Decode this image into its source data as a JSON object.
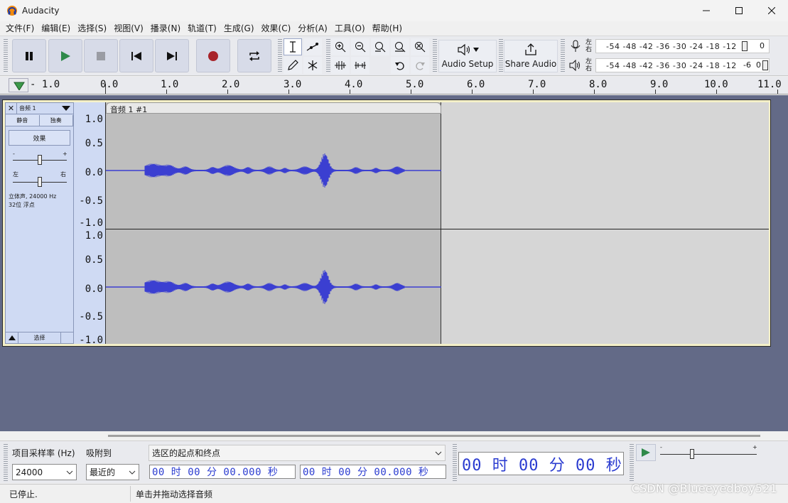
{
  "window": {
    "title": "Audacity"
  },
  "menu": [
    "文件(F)",
    "编辑(E)",
    "选择(S)",
    "视图(V)",
    "播录(N)",
    "轨道(T)",
    "生成(G)",
    "效果(C)",
    "分析(A)",
    "工具(O)",
    "帮助(H)"
  ],
  "toolbar": {
    "audio_setup_label": "Audio Setup",
    "share_audio_label": "Share Audio",
    "record_meter_ticks": "-54 -48 -42 -36 -30 -24 -18 -12",
    "record_meter_end": "0",
    "play_meter_ticks": "-54 -48 -42 -36 -30 -24 -18 -12",
    "play_meter_end": "-6  0",
    "left_label": "左",
    "right_label": "右"
  },
  "ruler": {
    "labels": [
      "- 1.0",
      "0.0",
      "1.0",
      "2.0",
      "3.0",
      "4.0",
      "5.0",
      "6.0",
      "7.0",
      "8.0",
      "9.0",
      "10.0",
      "11.0"
    ]
  },
  "track": {
    "name": "音频 1",
    "mute": "静音",
    "solo": "独奏",
    "effects": "效果",
    "gain_minus": "-",
    "gain_plus": "+",
    "pan_left": "左",
    "pan_right": "右",
    "info_line1": "立体声, 24000 Hz",
    "info_line2": "32位 浮点",
    "select": "选择",
    "clip_title": "音频 1 #1",
    "vruler_labels": [
      "1.0",
      "0.5",
      "0.0",
      "-0.5",
      "-1.0"
    ],
    "wave_color": "#3b3fd1"
  },
  "selection_toolbar": {
    "project_rate_label": "项目采样率 (Hz)",
    "snap_label": "吸附到",
    "rate_value": "24000",
    "snap_value": "最近的",
    "selection_mode": "选区的起点和终点",
    "start_time": "00 时 00 分 00.000 秒",
    "end_time": "00 时 00 分 00.000 秒",
    "audio_position": "00 时 00 分 00 秒"
  },
  "status": {
    "state": "已停止.",
    "hint": "单击并拖动选择音频"
  },
  "watermark": "CSDN @Blueeyedboy521"
}
